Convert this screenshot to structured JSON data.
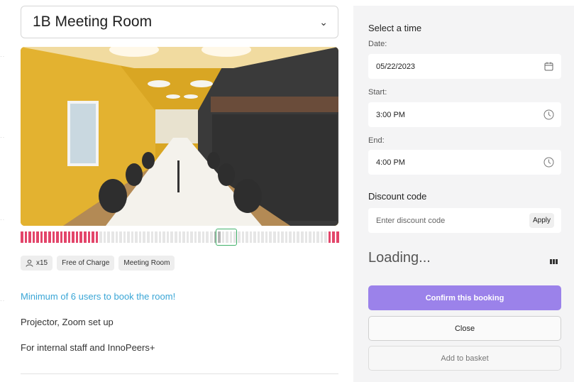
{
  "room": {
    "title": "1B Meeting Room",
    "capacity_label": "x15",
    "tags": [
      "Free of Charge",
      "Meeting Room"
    ],
    "min_users_note": "Minimum of 6 users to book the room!",
    "description_lines": [
      "Projector, Zoom set up",
      "For internal staff and InnoPeers+"
    ]
  },
  "timeline": {
    "slots": [
      "booked",
      "booked",
      "booked",
      "booked",
      "booked",
      "booked",
      "booked",
      "booked",
      "booked",
      "booked",
      "booked",
      "booked",
      "booked",
      "booked",
      "booked",
      "booked",
      "booked",
      "booked",
      "booked",
      "booked",
      "free",
      "free",
      "free",
      "free",
      "free",
      "free",
      "free",
      "free",
      "free",
      "free",
      "free",
      "free",
      "free",
      "free",
      "free",
      "free",
      "free",
      "free",
      "free",
      "free",
      "free",
      "free",
      "free",
      "free",
      "free",
      "free",
      "free",
      "free",
      "free",
      "selected",
      "selected",
      "free",
      "free",
      "free",
      "free",
      "free",
      "free",
      "free",
      "free",
      "free",
      "free",
      "free",
      "free",
      "free",
      "free",
      "free",
      "free",
      "free",
      "free",
      "free",
      "free",
      "free",
      "free",
      "free",
      "free",
      "free",
      "free",
      "free",
      "booked",
      "booked",
      "booked"
    ]
  },
  "booking": {
    "heading": "Select a time",
    "date_label": "Date:",
    "date_value": "05/22/2023",
    "start_label": "Start:",
    "start_value": "3:00 PM",
    "end_label": "End:",
    "end_value": "4:00 PM",
    "discount_title": "Discount code",
    "discount_placeholder": "Enter discount code",
    "apply_label": "Apply",
    "loading_text": "Loading...",
    "confirm_label": "Confirm this booking",
    "close_label": "Close",
    "basket_label": "Add to basket"
  },
  "colors": {
    "accent": "#9b82ea",
    "booked": "#e3456a",
    "link": "#3aa6d6",
    "selection": "#41b26a"
  },
  "icons": {
    "dropdown": "chevron-down-icon",
    "calendar": "calendar-icon",
    "clock": "clock-icon",
    "person": "person-icon",
    "bars": "bars-icon"
  }
}
